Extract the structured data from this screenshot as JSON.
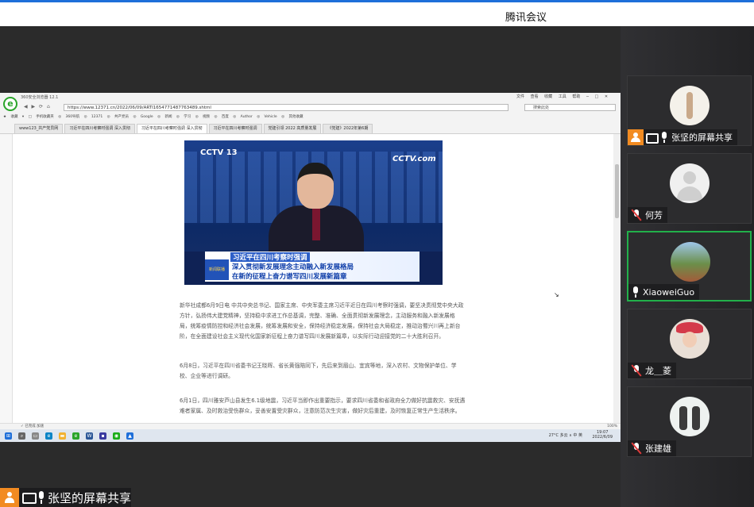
{
  "app": {
    "title": "腾讯会议"
  },
  "shared_screen": {
    "browser_title": "360安全浏览器 12.1",
    "menu": "文件 查看 收藏 工具 帮助 ─ □ ✕",
    "nav_buttons": "◀ ▶ ⟳ ⌂",
    "address": "https://www.12371.cn/2022/06/09/ARTI1654771487763489.shtml",
    "search_placeholder": "搜索此处",
    "favorites": "★ 收藏 ▾ □ 手机收藏夹 ◎ 360导航 ◎ 12371 ◎ 共产党员 ◎ Google ◎ 新闻 ◎ 学习 ◎ 视频 ◎ 百度 ◎ Author ◎ Vehicle ◎ 其他收藏",
    "tabs": [
      "www123_共产党员网",
      "习近平在四川考察时强调 深入贯彻",
      "习近平在四川考察时强调 深入贯彻",
      "习近平在四川考察时强调",
      "党建引领 2022 高质量发展",
      "《党建》2022年第6期"
    ],
    "video_logo_left": "CCTV 13",
    "video_logo_right": "CCTV.com",
    "caption_badge": "新闻联播",
    "caption_lines": [
      "习近平在四川考察时强调",
      "深入贯彻新发展理念主动融入新发展格局",
      "在新的征程上奋力谱写四川发展新篇章"
    ],
    "paragraphs": [
      "新华社成都6月9日电 中共中央总书记、国家主席、中央军委主席习近平近日在四川考察时强调，要坚决贯彻党中央大政方针，弘扬伟大建党精神，坚持稳中求进工作总基调，完整、准确、全面贯彻新发展理念，主动服务和融入新发展格局，统筹疫情防控和经济社会发展，统筹发展和安全，保持经济稳定发展，保持社会大局稳定，推动治蜀兴川再上新台阶，在全面建设社会主义现代化国家新征程上奋力谱写四川发展新篇章，以实际行动迎接党的二十大胜利召开。",
      "6月8日，习近平在四川省委书记王晓晖、省长黄强陪同下，先后来到眉山、宜宾等地，深入农村、文物保护单位、学校、企业等进行调研。",
      "6月1日，四川雅安芦山县发生6.1级地震，习近平当即作出重要指示，要求四川省委和省政府全力做好抗震救灾、安抚遇难者家属、及时救治受伤群众，妥善安置受灾群众，注意防范次生灾害，做好灾后重建，及时恢复正常生产生活秩序。"
    ],
    "status_left": "✓ 已完成 加速",
    "status_zoom": "100%",
    "tray": "27°C 多云 ∧ 中 英",
    "clock_time": "19:07",
    "clock_date": "2022/6/09"
  },
  "share_indicator": {
    "label": "张坚的屏幕共享"
  },
  "participants": [
    {
      "name": "张坚的屏幕共享",
      "sharing": true,
      "muted": false
    },
    {
      "name": "何芳",
      "sharing": false,
      "muted": true
    },
    {
      "name": "XiaoweiGuo",
      "sharing": false,
      "muted": false,
      "active": true
    },
    {
      "name": "龙＿菱",
      "sharing": false,
      "muted": true
    },
    {
      "name": "张建雄",
      "sharing": false,
      "muted": true
    }
  ],
  "colors": {
    "accent": "#1e6fd9",
    "share_orange": "#f28b21",
    "active_speaker": "#22b04a",
    "muted_red": "#e03b3b"
  }
}
